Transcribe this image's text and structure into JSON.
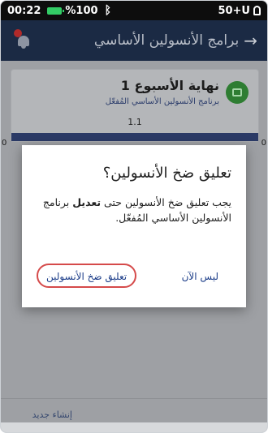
{
  "status_bar": {
    "time": "00:22",
    "battery_pct": "%100",
    "bluetooth_icon": "bluetooth-icon",
    "right_text": "50+U"
  },
  "header": {
    "title": "برامج الأنسولين الأساسي",
    "back_icon": "arrow-right-icon",
    "bell_icon": "bell-icon"
  },
  "card": {
    "title": "نهاية الأسبوع 1",
    "subtitle": "برنامج الأنسولين الأساسي المُفعّل",
    "value": "1.1",
    "axis_left": "0",
    "axis_right": "0",
    "icon": "calendar-icon"
  },
  "dialog": {
    "title": "تعليق ضخ الأنسولين؟",
    "body_prefix": "يجب تعليق ضخ الأنسولين حتى ",
    "body_bold": "تعديل",
    "body_suffix": " برنامج الأنسولين الأساسي المُفعّل.",
    "not_now_label": "ليس الآن",
    "suspend_label": "تعليق ضخ الأنسولين"
  },
  "footer": {
    "create_new": "إنشاء جديد"
  },
  "colors": {
    "header_bg": "#1b2a44",
    "accent_link": "#1e3f8a",
    "highlight_ring": "#d54a4a",
    "battery": "#33cc66"
  }
}
